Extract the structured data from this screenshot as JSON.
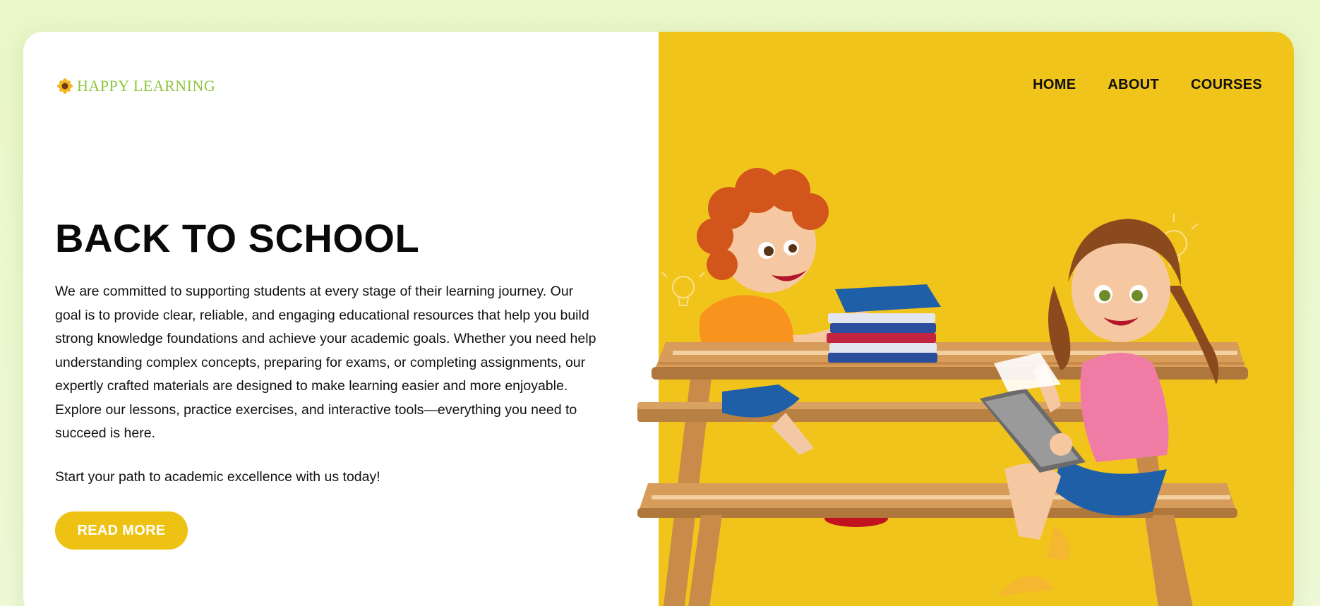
{
  "brand": {
    "logo_text": "HAPPY LEARNING",
    "logo_icon": "sunflower-icon",
    "color": "#8dc63f"
  },
  "nav": {
    "items": [
      {
        "label": "HOME"
      },
      {
        "label": "ABOUT"
      },
      {
        "label": "COURSES"
      }
    ]
  },
  "hero": {
    "title": "BACK TO SCHOOL",
    "description": "We are committed to supporting students at every stage of their learning journey. Our goal is to provide clear, reliable, and engaging educational resources that help you build strong knowledge foundations and achieve your academic goals. Whether you need help understanding complex concepts, preparing for exams, or completing assignments, our expertly crafted materials are designed to make learning easier and more enjoyable. Explore our lessons, practice exercises, and interactive tools—everything you need to succeed is here.",
    "cta_text": "Start your path to academic excellence with us today!",
    "button_label": "READ MORE",
    "accent_color": "#f1c41b",
    "button_color": "#eec212"
  },
  "illustration": {
    "subject": "two-children-at-picnic-table-illustration"
  }
}
